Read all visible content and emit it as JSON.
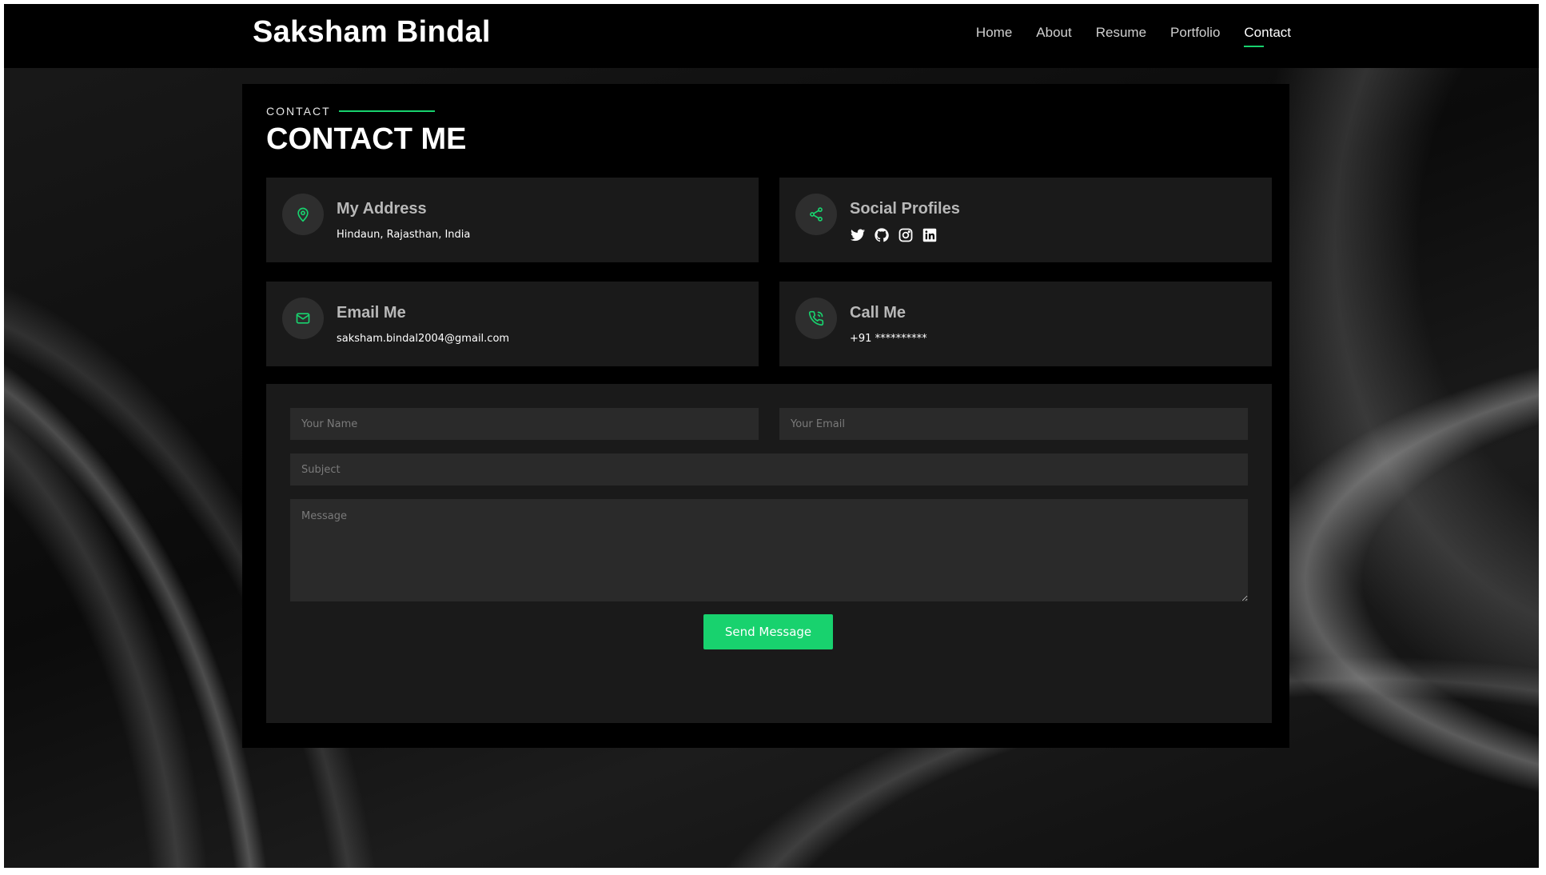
{
  "brand": "Saksham Bindal",
  "nav": [
    "Home",
    "About",
    "Resume",
    "Portfolio",
    "Contact"
  ],
  "nav_active": "Contact",
  "section": {
    "label": "CONTACT",
    "title": "CONTACT ME"
  },
  "cards": {
    "address": {
      "title": "My Address",
      "text": "Hindaun, Rajasthan, India",
      "icon": "map-pin-icon"
    },
    "social": {
      "title": "Social Profiles",
      "icons": [
        "twitter-icon",
        "github-icon",
        "instagram-icon",
        "linkedin-icon"
      ]
    },
    "email": {
      "title": "Email Me",
      "text": "saksham.bindal2004@gmail.com",
      "icon": "mail-icon"
    },
    "call": {
      "title": "Call Me",
      "text": "+91 **********",
      "icon": "phone-icon"
    }
  },
  "form": {
    "name_placeholder": "Your Name",
    "email_placeholder": "Your Email",
    "subject_placeholder": "Subject",
    "message_placeholder": "Message",
    "submit_label": "Send Message"
  },
  "colors": {
    "accent": "#18d26e",
    "card_bg": "#1a1a1a",
    "field_bg": "#2a2a2a"
  }
}
